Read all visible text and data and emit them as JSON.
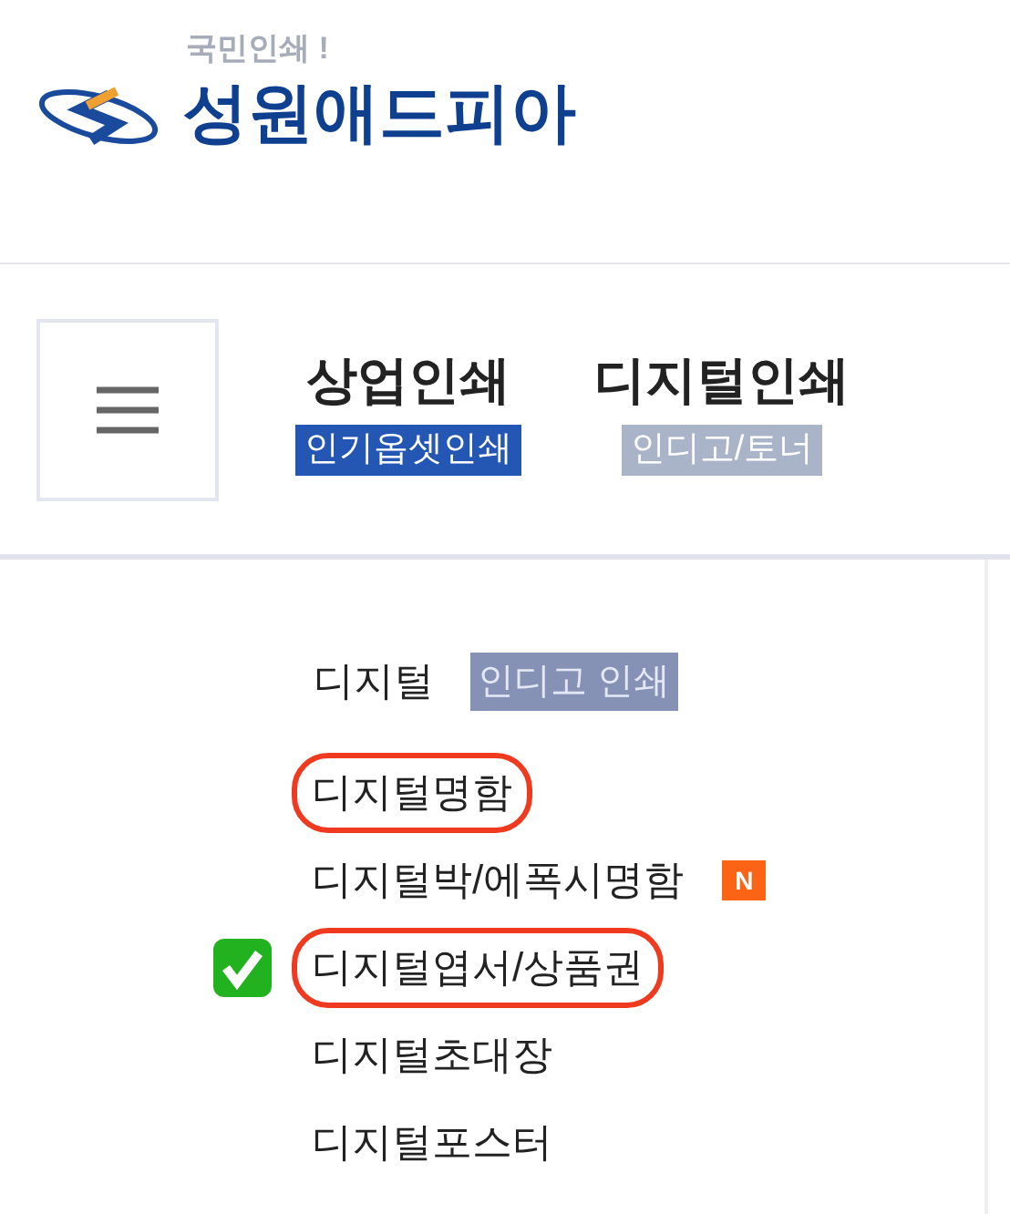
{
  "logo": {
    "tagline": "국민인쇄 !",
    "name": "성원애드피아"
  },
  "nav": [
    {
      "label": "상업인쇄",
      "sub": "인기옵셋인쇄",
      "selected": true
    },
    {
      "label": "디지털인쇄",
      "sub": "인디고/토너",
      "selected": false
    }
  ],
  "section": {
    "title": "디지털",
    "badge": "인디고 인쇄"
  },
  "items": [
    {
      "label": "디지털명함",
      "circled": true,
      "checked": false
    },
    {
      "label": "디지털박/에폭시명함",
      "circled": false,
      "checked": false,
      "badge": "N"
    },
    {
      "label": "디지털엽서/상품권",
      "circled": true,
      "checked": true
    },
    {
      "label": "디지털초대장",
      "circled": false,
      "checked": false
    },
    {
      "label": "디지털포스터",
      "circled": false,
      "checked": false
    }
  ]
}
